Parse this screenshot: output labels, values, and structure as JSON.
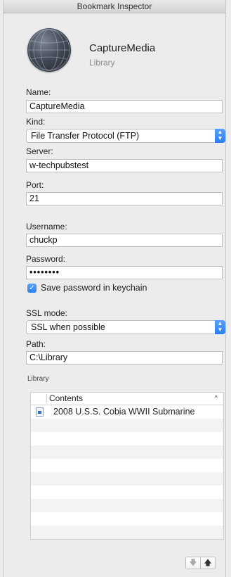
{
  "window": {
    "title": "Bookmark Inspector"
  },
  "header": {
    "name": "CaptureMedia",
    "kind": "Library"
  },
  "form": {
    "name_label": "Name:",
    "name_value": "CaptureMedia",
    "kind_label": "Kind:",
    "kind_value": "File Transfer Protocol (FTP)",
    "server_label": "Server:",
    "server_value": "w-techpubstest",
    "port_label": "Port:",
    "port_value": "21",
    "username_label": "Username:",
    "username_value": "chuckp",
    "password_label": "Password:",
    "password_value": "••••••••",
    "save_password_label": "Save password in keychain",
    "save_password_checked": true,
    "ssl_label": "SSL mode:",
    "ssl_value": "SSL when possible",
    "path_label": "Path:",
    "path_value": "C:\\Library"
  },
  "library": {
    "section_label": "Library",
    "column_header": "Contents",
    "items": [
      "2008 U.S.S. Cobia WWII Submarine"
    ]
  },
  "icons": {
    "stepper": "chevron-up-down-icon",
    "sort": "sort-ascending-icon",
    "move_down": "arrow-down-icon",
    "move_up": "arrow-up-icon",
    "doc": "document-icon"
  },
  "colors": {
    "accent": "#2b7ef0",
    "background": "#ececec"
  }
}
